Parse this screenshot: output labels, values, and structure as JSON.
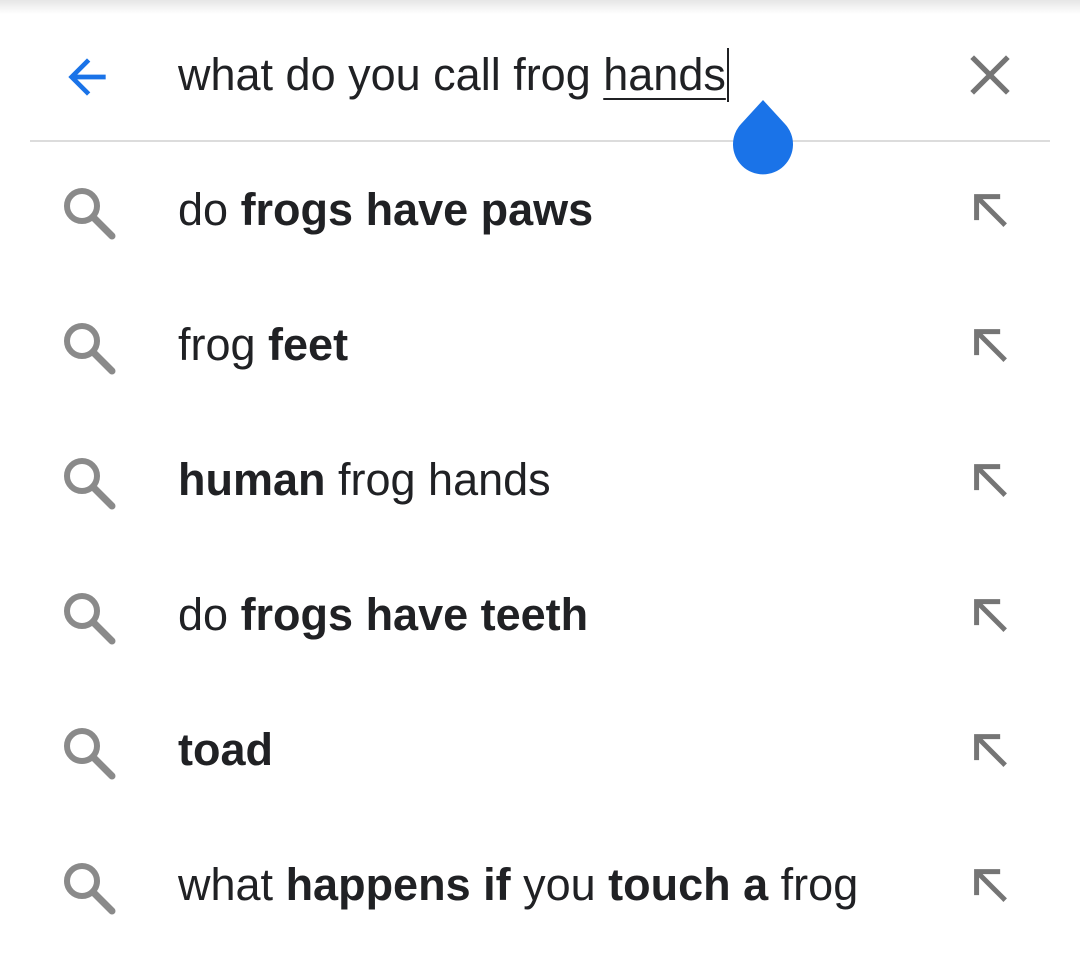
{
  "colors": {
    "accent": "#1a73e8",
    "text": "#202124",
    "icon_gray": "#8a8a8a",
    "divider": "#dcdcdc"
  },
  "search": {
    "query_prefix": "what do you call frog ",
    "query_composing": "hands",
    "back_icon": "arrow-back-icon",
    "clear_icon": "close-icon"
  },
  "suggestions": [
    {
      "segments": [
        {
          "text": "do ",
          "bold": false
        },
        {
          "text": "frogs have paws",
          "bold": true
        }
      ]
    },
    {
      "segments": [
        {
          "text": "frog ",
          "bold": false
        },
        {
          "text": "feet",
          "bold": true
        }
      ]
    },
    {
      "segments": [
        {
          "text": "human",
          "bold": true
        },
        {
          "text": " frog hands",
          "bold": false
        }
      ]
    },
    {
      "segments": [
        {
          "text": "do ",
          "bold": false
        },
        {
          "text": "frogs have teeth",
          "bold": true
        }
      ]
    },
    {
      "segments": [
        {
          "text": "toad",
          "bold": true
        }
      ]
    },
    {
      "segments": [
        {
          "text": "what ",
          "bold": false
        },
        {
          "text": "happens if",
          "bold": true
        },
        {
          "text": " you ",
          "bold": false
        },
        {
          "text": "touch a",
          "bold": true
        },
        {
          "text": " frog",
          "bold": false
        }
      ]
    }
  ],
  "suggestion_icons": {
    "leading": "search-icon",
    "trailing": "arrow-up-left-icon"
  }
}
